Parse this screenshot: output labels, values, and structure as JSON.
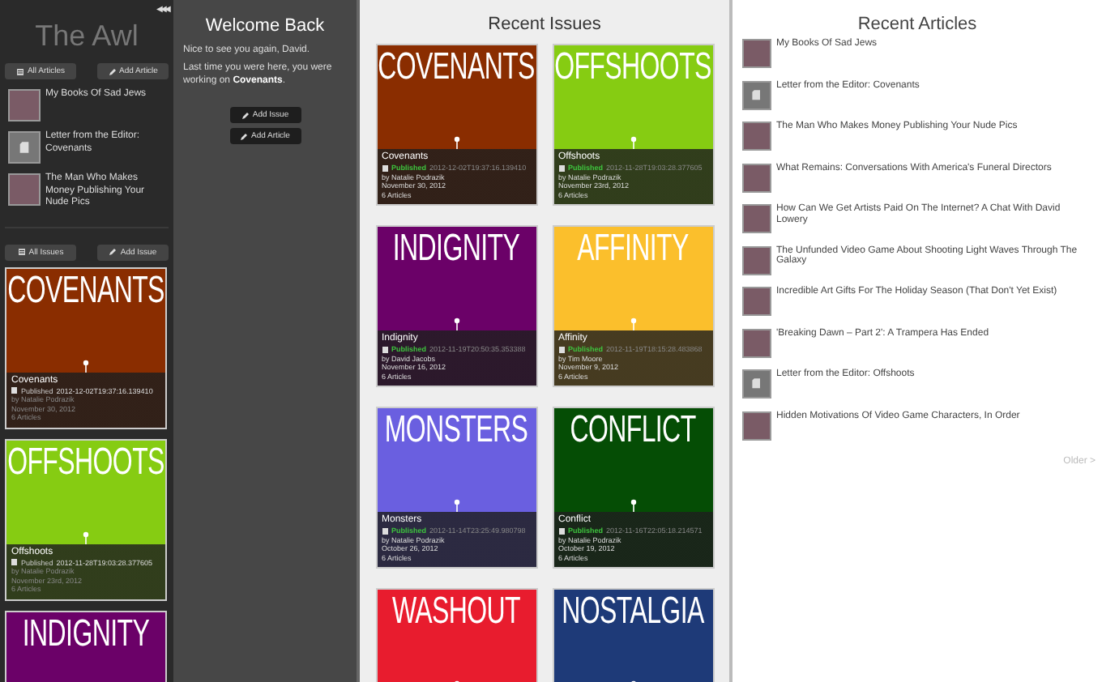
{
  "sidebar": {
    "title": "The Awl",
    "collapse_icon": "◀◀◀",
    "article_buttons": [
      "All Articles",
      "Add Article"
    ],
    "articles": [
      {
        "title": "My Books Of Sad Jews",
        "kind": "photo"
      },
      {
        "title": "Letter from the Editor: Covenants",
        "kind": "document"
      },
      {
        "title": "The Man Who Makes Money Publishing Your Nude Pics",
        "kind": "photo"
      }
    ],
    "issue_buttons": [
      "All Issues",
      "Add Issue"
    ],
    "issues": [
      {
        "cover_title": "COVENANTS",
        "color": "#8a2d00",
        "name": "Covenants",
        "status": "Published",
        "timestamp": "2012-12-02T19:37:16.139410",
        "author": "by Natalie Podrazik",
        "date": "November 30, 2012",
        "count": "6 Articles"
      },
      {
        "cover_title": "OFFSHOOTS",
        "color": "#86cc12",
        "name": "Offshoots",
        "status": "Published",
        "timestamp": "2012-11-28T19:03:28.377605",
        "author": "by Natalie Podrazik",
        "date": "November 23rd, 2012",
        "count": "6 Articles"
      },
      {
        "cover_title": "INDIGNITY",
        "color": "#6b0168"
      }
    ]
  },
  "welcome": {
    "title": "Welcome Back",
    "greeting": "Nice to see you again, David.",
    "last_time": "Last time you were here, you were working on **Covenants**.",
    "buttons": [
      "Add Issue",
      "Add Article"
    ]
  },
  "recent_issues": {
    "title": "Recent Issues",
    "issues": [
      {
        "cover_title": "COVENANTS",
        "color": "#8a2d00",
        "name": "Covenants",
        "status": "Published",
        "timestamp": "2012-12-02T19:37:16.139410",
        "author": "by Natalie Podrazik",
        "date": "November 30, 2012",
        "count": "6 Articles"
      },
      {
        "cover_title": "OFFSHOOTS",
        "color": "#86cc12",
        "name": "Offshoots",
        "status": "Published",
        "timestamp": "2012-11-28T19:03:28.377605",
        "author": "by Natalie Podrazik",
        "date": "November 23rd, 2012",
        "count": "6 Articles"
      },
      {
        "cover_title": "INDIGNITY",
        "color": "#6b0168",
        "name": "Indignity",
        "status": "Published",
        "timestamp": "2012-11-19T20:50:35.353388",
        "author": "by David Jacobs",
        "date": "November 16, 2012",
        "count": "6 Articles"
      },
      {
        "cover_title": "AFFINITY",
        "color": "#fbbf2c",
        "name": "Affinity",
        "status": "Published",
        "timestamp": "2012-11-19T18:15:28.483868",
        "author": "by Tim Moore",
        "date": "November 9, 2012",
        "count": "6 Articles"
      },
      {
        "cover_title": "MONSTERS",
        "color": "#6a5fe0",
        "name": "Monsters",
        "status": "Published",
        "timestamp": "2012-11-14T23:25:49.980798",
        "author": "by Natalie Podrazik",
        "date": "October 26, 2012",
        "count": "6 Articles"
      },
      {
        "cover_title": "CONFLICT",
        "color": "#054d05",
        "name": "Conflict",
        "status": "Published",
        "timestamp": "2012-11-16T22:05:18.214571",
        "author": "by Natalie Podrazik",
        "date": "October 19, 2012",
        "count": "6 Articles"
      },
      {
        "cover_title": "WASHOUT",
        "color": "#e81c2e"
      },
      {
        "cover_title": "NOSTALGIA",
        "color": "#1e3a78"
      }
    ]
  },
  "recent_articles": {
    "title": "Recent Articles",
    "articles": [
      {
        "title": "My Books Of Sad Jews",
        "kind": "photo"
      },
      {
        "title": "Letter from the Editor: Covenants",
        "kind": "document"
      },
      {
        "title": "The Man Who Makes Money Publishing Your Nude Pics",
        "kind": "photo"
      },
      {
        "title": "What Remains: Conversations With America's Funeral Directors",
        "kind": "photo"
      },
      {
        "title": "How Can We Get Artists Paid On The Internet? A Chat With David Lowery",
        "kind": "photo"
      },
      {
        "title": "The Unfunded Video Game About Shooting Light Waves Through The Galaxy",
        "kind": "photo"
      },
      {
        "title": "Incredible Art Gifts For The Holiday Season (That Don't Yet Exist)",
        "kind": "photo"
      },
      {
        "title": "'Breaking Dawn – Part 2': A Trampera Has Ended",
        "kind": "photo"
      },
      {
        "title": "Letter from the Editor: Offshoots",
        "kind": "document"
      },
      {
        "title": "Hidden Motivations Of Video Game Characters, In Order",
        "kind": "photo"
      }
    ],
    "older": "Older >"
  }
}
